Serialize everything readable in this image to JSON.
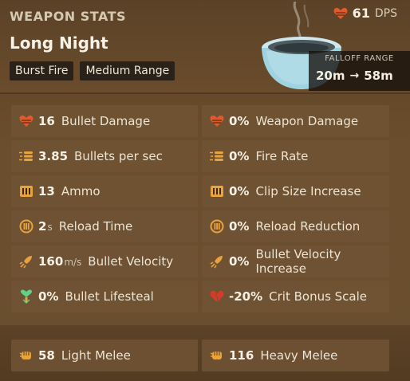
{
  "header": {
    "title": "WEAPON STATS",
    "weapon_name": "Long Night",
    "tags": [
      "Burst Fire",
      "Medium Range"
    ],
    "dps_value": "61",
    "dps_unit": "DPS",
    "falloff": {
      "label": "FALLOFF RANGE",
      "from": "20m",
      "to": "58m"
    }
  },
  "stats": [
    {
      "icon": "heart-icon",
      "value": "16",
      "unit": "",
      "label": "Bullet Damage"
    },
    {
      "icon": "heart-icon",
      "value": "0%",
      "unit": "",
      "label": "Weapon Damage"
    },
    {
      "icon": "bullets-icon",
      "value": "3.85",
      "unit": "",
      "label": "Bullets per sec"
    },
    {
      "icon": "bullets-icon",
      "value": "0%",
      "unit": "",
      "label": "Fire Rate"
    },
    {
      "icon": "ammo-icon",
      "value": "13",
      "unit": "",
      "label": "Ammo"
    },
    {
      "icon": "ammo-icon",
      "value": "0%",
      "unit": "",
      "label": "Clip Size Increase"
    },
    {
      "icon": "reload-icon",
      "value": "2",
      "unit": "s",
      "label": "Reload Time"
    },
    {
      "icon": "reload-icon",
      "value": "0%",
      "unit": "",
      "label": "Reload Reduction"
    },
    {
      "icon": "velocity-icon",
      "value": "160",
      "unit": "m/s",
      "label": "Bullet Velocity"
    },
    {
      "icon": "velocity-icon",
      "value": "0%",
      "unit": "",
      "label": "Bullet Velocity Increase"
    },
    {
      "icon": "lifesteal-icon",
      "value": "0%",
      "unit": "",
      "label": "Bullet Lifesteal"
    },
    {
      "icon": "broken-heart-icon",
      "value": "-20%",
      "unit": "",
      "label": "Crit Bonus Scale"
    }
  ],
  "melee": [
    {
      "icon": "fist-icon",
      "value": "58",
      "label": "Light Melee"
    },
    {
      "icon": "fist-icon",
      "value": "116",
      "label": "Heavy Melee"
    }
  ],
  "colors": {
    "accent": "#e8a33c",
    "heart": "#e25a2c",
    "lifesteal": "#5fd08a",
    "panel": "#705434"
  }
}
